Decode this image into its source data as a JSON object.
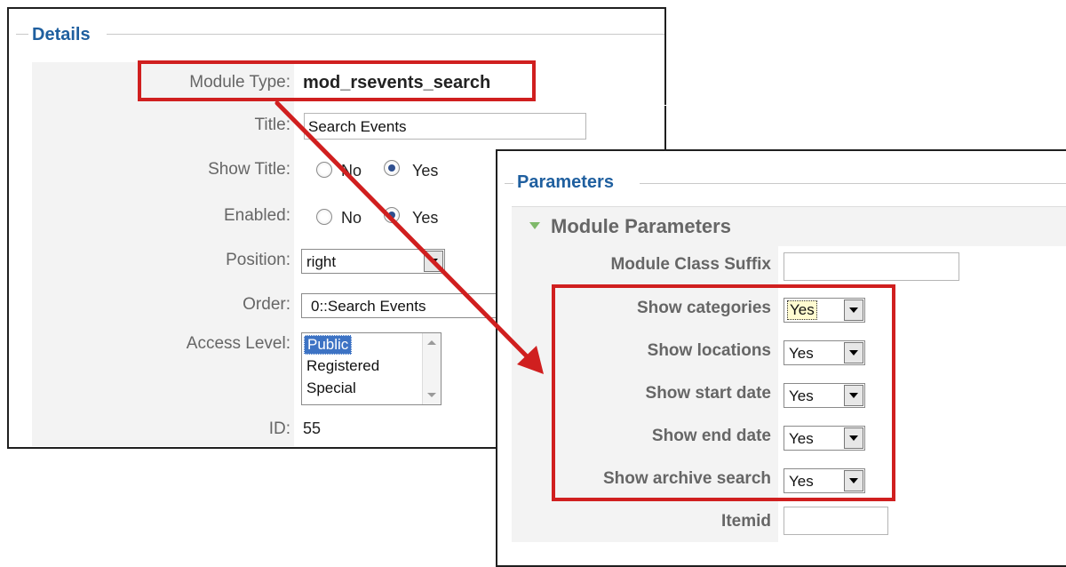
{
  "details": {
    "legend": "Details",
    "module_type_label": "Module Type:",
    "module_type_value": "mod_rsevents_search",
    "title_label": "Title:",
    "title_value": "Search Events",
    "show_title_label": "Show Title:",
    "show_title_no": "No",
    "show_title_yes": "Yes",
    "enabled_label": "Enabled:",
    "enabled_no": "No",
    "enabled_yes": "Yes",
    "position_label": "Position:",
    "position_value": "right",
    "order_label": "Order:",
    "order_value": "0::Search Events",
    "access_label": "Access Level:",
    "access_options": [
      "Public",
      "Registered",
      "Special"
    ],
    "access_selected": "Public",
    "id_label": "ID:",
    "id_value": "55"
  },
  "parameters": {
    "legend": "Parameters",
    "section_title": "Module Parameters",
    "class_suffix_label": "Module Class Suffix",
    "class_suffix_value": "",
    "rows": [
      {
        "label": "Show categories",
        "value": "Yes"
      },
      {
        "label": "Show locations",
        "value": "Yes"
      },
      {
        "label": "Show start date",
        "value": "Yes"
      },
      {
        "label": "Show end date",
        "value": "Yes"
      },
      {
        "label": "Show archive search",
        "value": "Yes"
      }
    ],
    "itemid_label": "Itemid",
    "itemid_value": ""
  },
  "annotations": {
    "highlight_color": "#d01f1f",
    "legend_color": "#1f5f9f",
    "icons": [
      "expand-triangle-icon",
      "dropdown-arrow-icon",
      "annotation-arrow-icon"
    ]
  }
}
